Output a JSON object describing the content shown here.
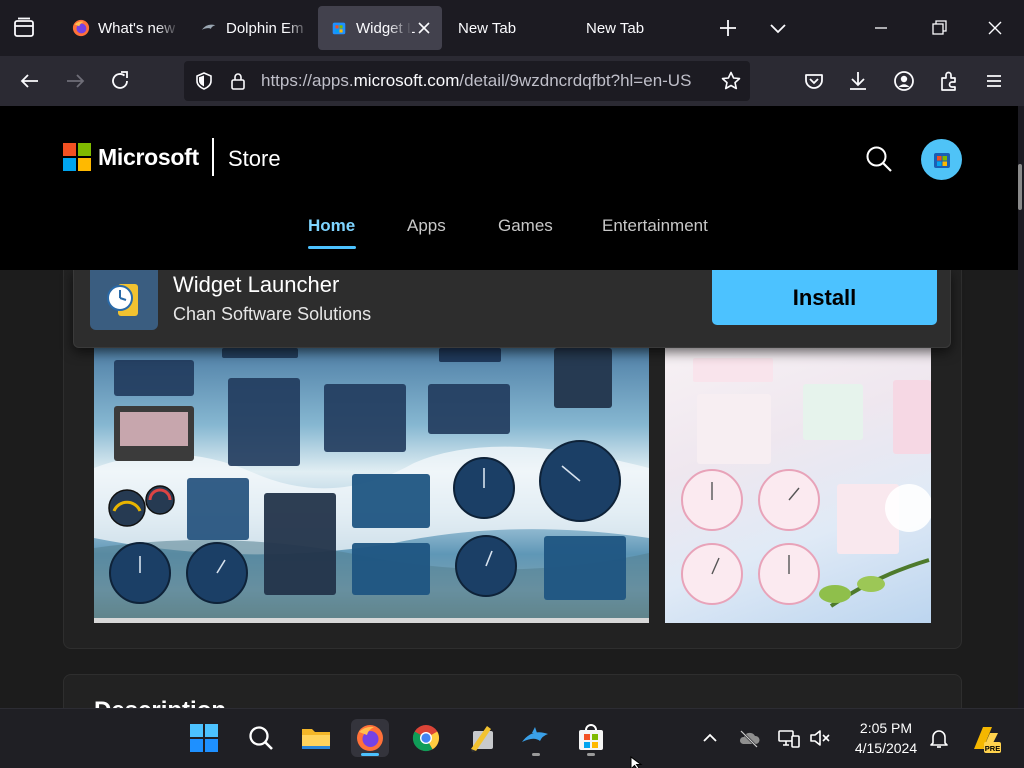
{
  "browser": {
    "tabs": [
      {
        "title": "What's new",
        "favicon": "firefox-icon",
        "active": false
      },
      {
        "title": "Dolphin Em",
        "favicon": "dolphin-icon",
        "active": false
      },
      {
        "title": "Widget L",
        "favicon": "store-icon",
        "active": true
      },
      {
        "title": "New Tab",
        "favicon": "",
        "active": false
      },
      {
        "title": "New Tab",
        "favicon": "",
        "active": false
      }
    ],
    "url_prefix": "https://apps.",
    "url_domain": "microsoft.com",
    "url_path": "/detail/9wzdncrdqfbt?hl=en-US"
  },
  "store": {
    "brand": "Microsoft",
    "section": "Store",
    "nav": [
      {
        "label": "Home",
        "active": true
      },
      {
        "label": "Apps",
        "active": false
      },
      {
        "label": "Games",
        "active": false
      },
      {
        "label": "Entertainment",
        "active": false
      }
    ]
  },
  "app": {
    "name": "Widget Launcher",
    "publisher": "Chan Software Solutions",
    "install_label": "Install"
  },
  "description_heading": "Description",
  "taskbar": {
    "apps": [
      "windows-start-icon",
      "search-icon",
      "file-explorer-icon",
      "firefox-icon",
      "chrome-icon",
      "paint-app-icon",
      "dolphin-icon",
      "microsoft-store-icon"
    ],
    "time": "2:05 PM",
    "date": "4/15/2024"
  },
  "colors": {
    "accent": "#4cc2ff",
    "ms_red": "#f25022",
    "ms_green": "#7fba00",
    "ms_blue": "#00a4ef",
    "ms_yellow": "#ffb900"
  }
}
